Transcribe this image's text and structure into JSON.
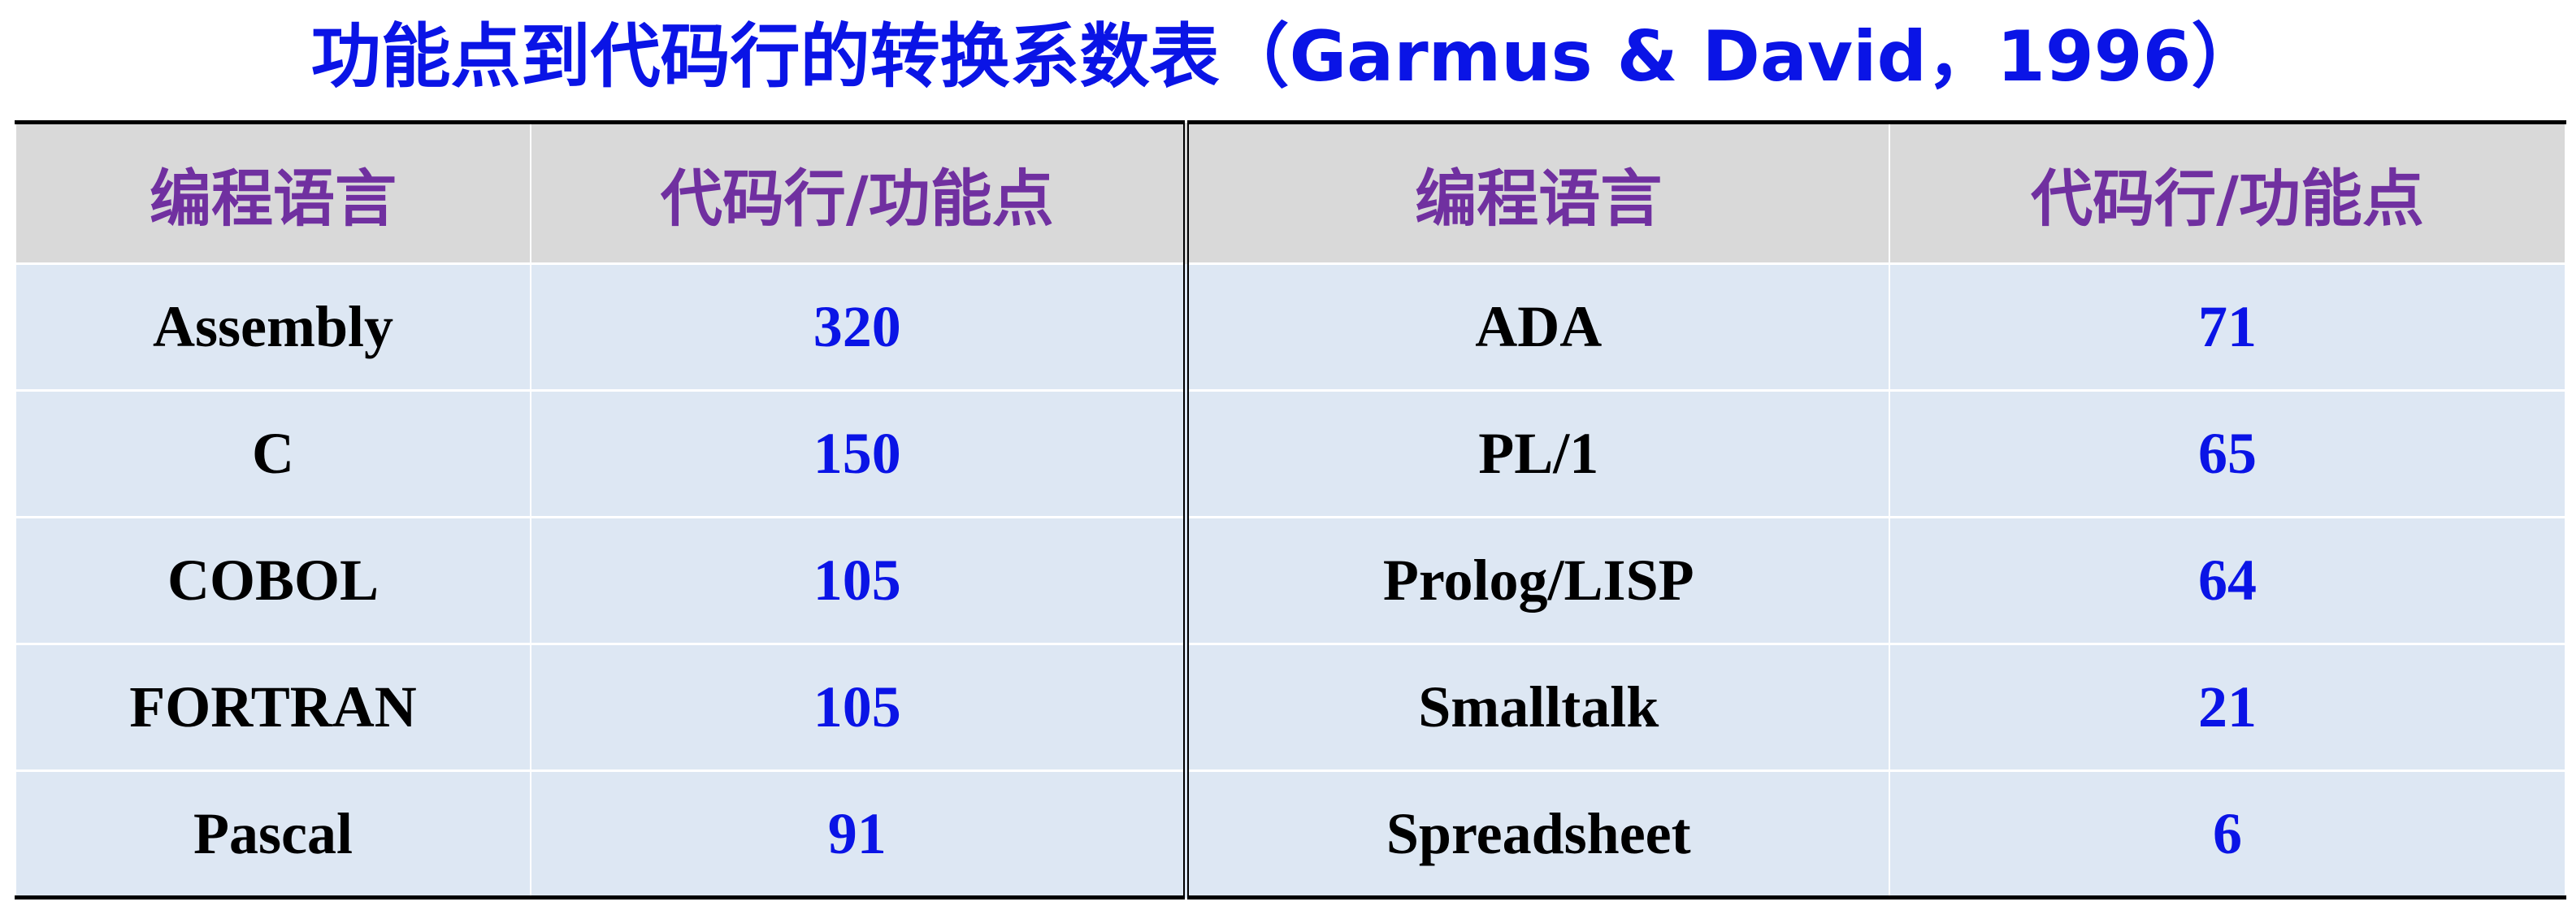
{
  "title": "功能点到代码行的转换系数表（Garmus & David，1996）",
  "table": {
    "headers": [
      "编程语言",
      "代码行/功能点",
      "编程语言",
      "代码行/功能点"
    ],
    "rows": [
      [
        "Assembly",
        "320",
        "ADA",
        "71"
      ],
      [
        "C",
        "150",
        "PL/1",
        "65"
      ],
      [
        "COBOL",
        "105",
        "Prolog/LISP",
        "64"
      ],
      [
        "FORTRAN",
        "105",
        "Smalltalk",
        "21"
      ],
      [
        "Pascal",
        "91",
        "Spreadsheet",
        "6"
      ]
    ]
  },
  "colors": {
    "title": "#0a14e6",
    "header_text": "#7030a0",
    "header_bg": "#d9d9d9",
    "row_bg": "#dde7f3",
    "value_text": "#0a14e6",
    "language_text": "#000000"
  }
}
